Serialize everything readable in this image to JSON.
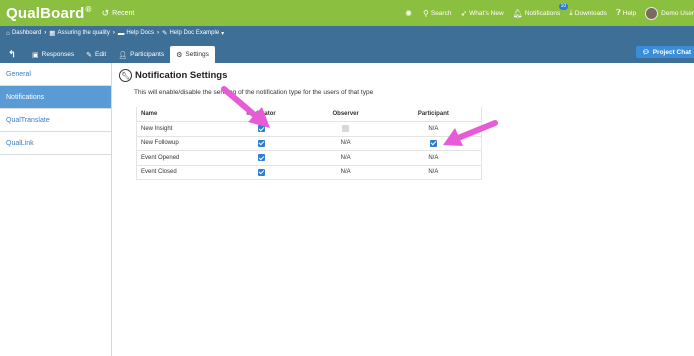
{
  "app": {
    "brand": "QualBoard",
    "brand_mark": "®",
    "recent_label": "Recent",
    "nav": {
      "search": "Search",
      "whats_new": "What's New",
      "notifications": "Notifications",
      "notifications_count": "10",
      "downloads": "Downloads",
      "help": "Help",
      "user": "Demo User"
    }
  },
  "breadcrumb": [
    {
      "label": "Dashboard",
      "icon": "home-icon"
    },
    {
      "label": "Assuring the quality",
      "icon": "grid-icon"
    },
    {
      "label": "Help Docs",
      "icon": "folder-icon"
    },
    {
      "label": "Help Doc Example",
      "icon": "chat-icon"
    }
  ],
  "tabs": [
    {
      "label": "Responses",
      "icon": "responses-icon"
    },
    {
      "label": "Edit",
      "icon": "edit-icon"
    },
    {
      "label": "Participants",
      "icon": "user-icon"
    },
    {
      "label": "Settings",
      "icon": "gear-icon",
      "active": true
    }
  ],
  "project_chat": "Project Chat",
  "sidebar": {
    "items": [
      {
        "label": "General"
      },
      {
        "label": "Notifications",
        "active": true
      },
      {
        "label": "QualTranslate"
      },
      {
        "label": "QualLink"
      }
    ]
  },
  "settings": {
    "title": "Notification Settings",
    "description": "This will enable/disable the sending of the notification type for the users of that type",
    "columns": [
      "Name",
      "Moderator",
      "Observer",
      "Participant"
    ],
    "rows": [
      {
        "name": "New Insight",
        "moderator": "checked",
        "observer": "unchecked",
        "participant": "N/A"
      },
      {
        "name": "New Followup",
        "moderator": "checked",
        "observer": "N/A",
        "participant": "checked"
      },
      {
        "name": "Event Opened",
        "moderator": "checked",
        "observer": "N/A",
        "participant": "N/A"
      },
      {
        "name": "Event Closed",
        "moderator": "checked",
        "observer": "N/A",
        "participant": "N/A"
      }
    ]
  },
  "colors": {
    "topbar": "#8bbf3f",
    "subbar": "#3e6f96",
    "accent": "#5b9bd5",
    "checkbox": "#2f7fd0",
    "annotation_arrow": "#e85bd6"
  }
}
